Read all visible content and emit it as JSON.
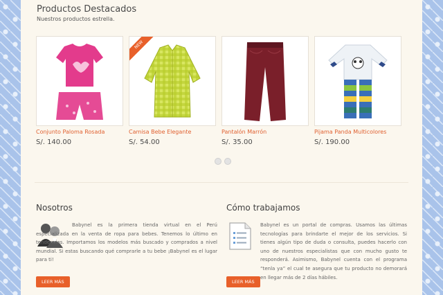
{
  "featured": {
    "title": "Productos Destacados",
    "subtitle": "Nuestros productos estrella.",
    "products": [
      {
        "name": "Conjunto Paloma Rosada",
        "price": "S/. 140.00",
        "badge": ""
      },
      {
        "name": "Camisa Bebe Elegante",
        "price": "S/. 54.00",
        "badge": "NEW"
      },
      {
        "name": "Pantalón Marrón",
        "price": "S/. 35.00",
        "badge": ""
      },
      {
        "name": "Pijama Panda Multicolores",
        "price": "S/. 190.00",
        "badge": ""
      }
    ],
    "pager": {
      "pages": 2,
      "active": 1
    }
  },
  "about": {
    "title": "Nosotros",
    "icon": "people-icon",
    "text": "Babynel es la primera tienda virtual en el Perú especializada en la venta de ropa para bebes. Tenemos lo último en tendencias. Importamos los modelos más buscado y comprados a nivel mundial. Si estas buscando qué comprarle a tu bebe ¡Babynel es el lugar para ti!",
    "button": "LEER MÁS"
  },
  "how": {
    "title": "Cómo trabajamos",
    "icon": "document-list-icon",
    "text": "Babynel es un portal de compras. Usamos las últimas tecnologías para brindarte el mejor de los servicios. Si tienes algún tipo de duda o consulta, puedes hacerlo con uno de nuestros especialistas que con mucho gusto te responderá. Asimismo, Babynel cuenta con el programa “tenla ya” el cual te asegura que tu producto no demorará en llegar más de 2 días hábiles.",
    "button": "LEER MÁS"
  },
  "colors": {
    "accent": "#e8602a",
    "background": "#fbf7ee",
    "pattern": "#a9c3ea"
  }
}
